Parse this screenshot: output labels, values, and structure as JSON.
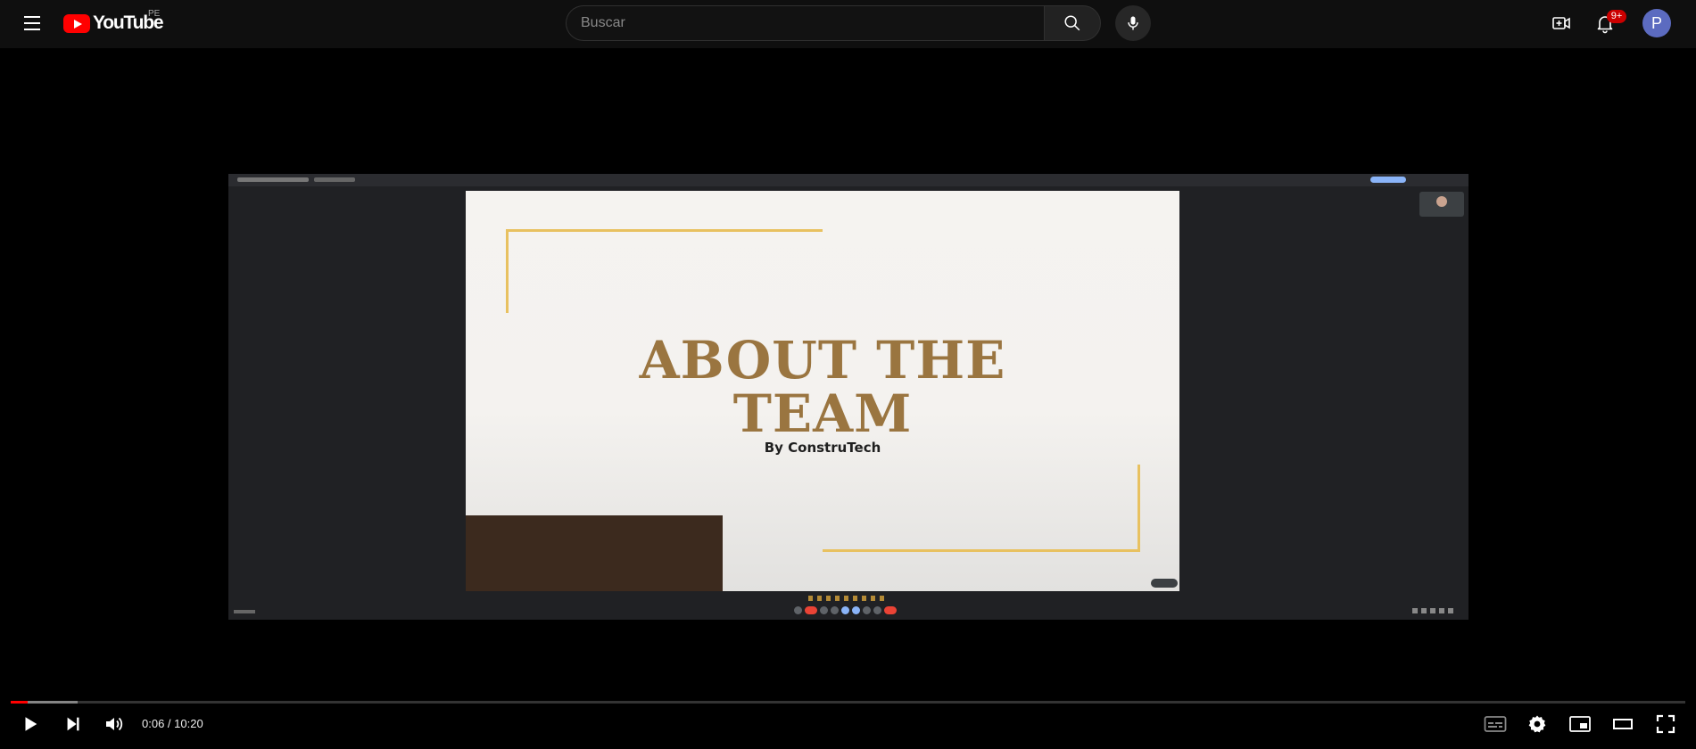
{
  "masthead": {
    "logo_text": "YouTube",
    "country_code": "PE",
    "search_placeholder": "Buscar",
    "notification_count": "9+",
    "avatar_letter": "P"
  },
  "slide": {
    "title_line1": "ABOUT THE",
    "title_line2": "TEAM",
    "subtitle": "By ConstruTech"
  },
  "player": {
    "current_time": "0:06",
    "separator": " / ",
    "duration": "10:20",
    "played_fraction": 0.01,
    "buffered_fraction": 0.04
  },
  "colors": {
    "brand_red": "#ff0000",
    "slide_title": "#9a7540",
    "slide_accent_gold": "#e8c160",
    "slide_block_brown": "#3c2a1e",
    "avatar_bg": "#5c6bc0"
  },
  "icons": [
    "menu-icon",
    "youtube-logo-icon",
    "search-icon",
    "mic-icon",
    "create-icon",
    "bell-icon",
    "play-icon",
    "next-icon",
    "volume-icon",
    "subtitles-icon",
    "settings-icon",
    "miniplayer-icon",
    "theater-icon",
    "fullscreen-icon"
  ]
}
